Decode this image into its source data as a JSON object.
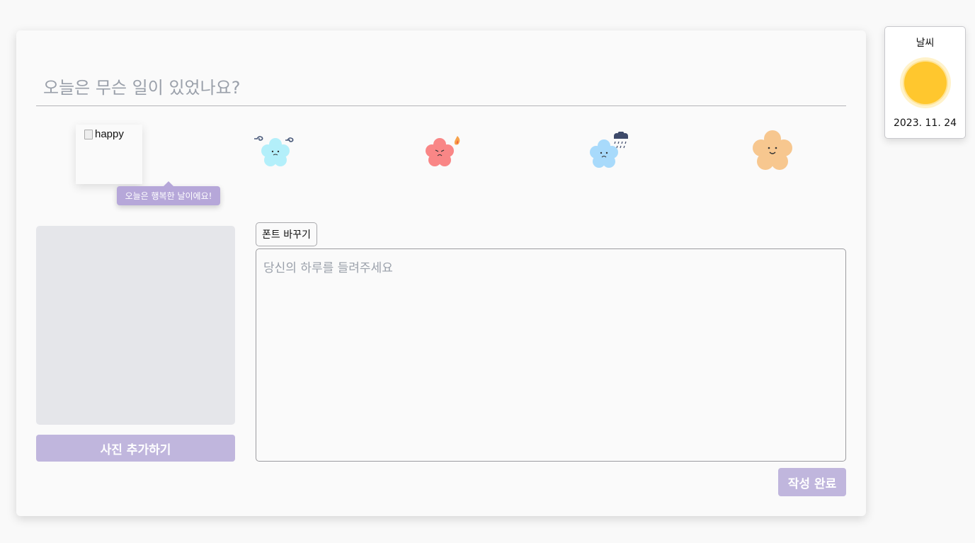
{
  "editor": {
    "title_placeholder": "오늘은 무슨 일이 있었나요?",
    "title_value": "",
    "body_placeholder": "당신의 하루를 들려주세요",
    "body_value": ""
  },
  "emotions": {
    "selected_alt": "happy",
    "selected_tooltip": "오늘은 행복한 날이에요!",
    "items": [
      {
        "name": "happy",
        "color": "#f7c27f",
        "icon": "happy-flower-icon"
      },
      {
        "name": "windy",
        "color": "#b3effa",
        "icon": "windy-flower-icon"
      },
      {
        "name": "angry",
        "color": "#f98686",
        "icon": "angry-flower-icon"
      },
      {
        "name": "sad",
        "color": "#a8dafb",
        "icon": "rainy-flower-icon"
      },
      {
        "name": "neutral",
        "color": "#f7c78f",
        "icon": "neutral-flower-icon"
      }
    ]
  },
  "actions": {
    "photo_add_label": "사진 추가하기",
    "font_change_label": "폰트 바꾸기",
    "submit_label": "작성 완료"
  },
  "weather": {
    "title": "날씨",
    "icon": "sun-icon",
    "date": "2023. 11. 24"
  },
  "colors": {
    "accent": "#c0b6dd",
    "tooltip": "#b6a7d9",
    "sun": "#ffc72e",
    "photo_placeholder": "#e5e6ea"
  }
}
